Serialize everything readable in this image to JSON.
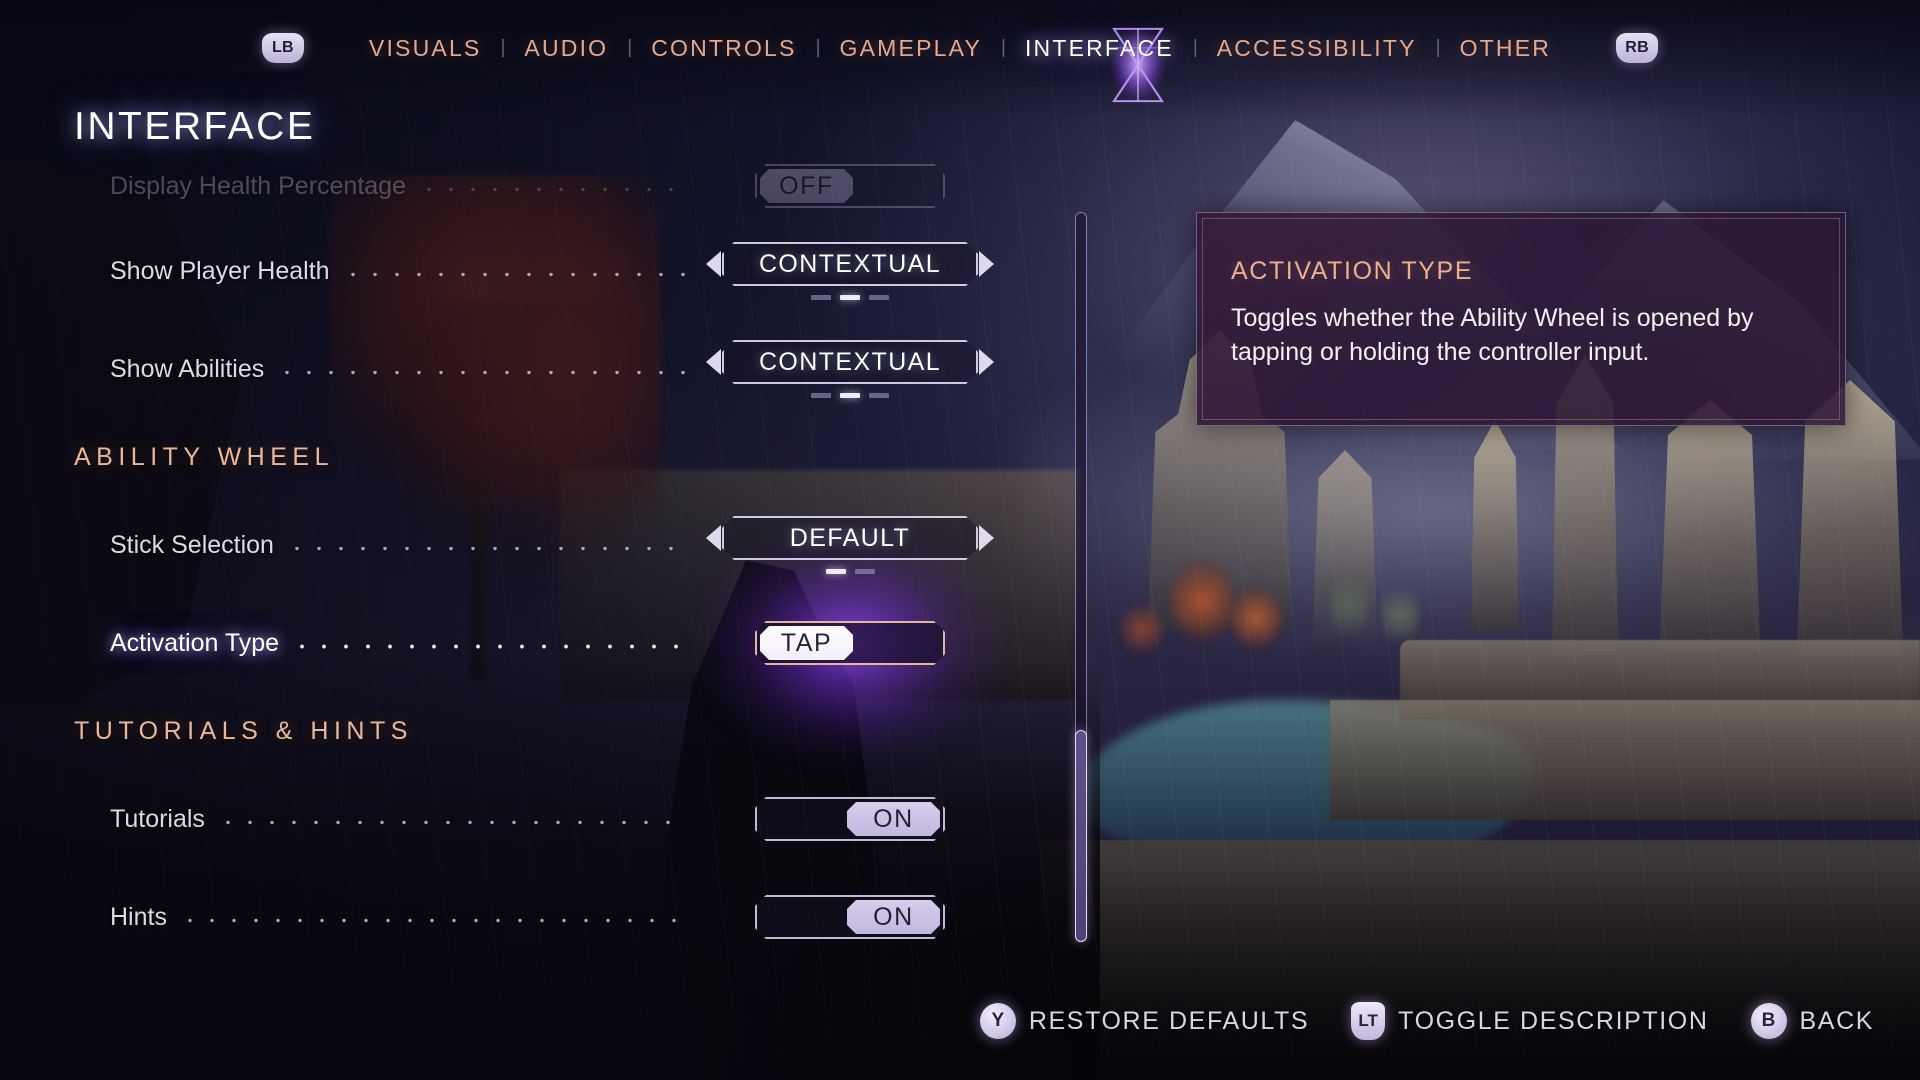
{
  "nav": {
    "left_bumper": "LB",
    "right_bumper": "RB",
    "separator": "|",
    "tabs": [
      {
        "label": "VISUALS",
        "active": false
      },
      {
        "label": "AUDIO",
        "active": false
      },
      {
        "label": "CONTROLS",
        "active": false
      },
      {
        "label": "GAMEPLAY",
        "active": false
      },
      {
        "label": "INTERFACE",
        "active": true
      },
      {
        "label": "ACCESSIBILITY",
        "active": false
      },
      {
        "label": "OTHER",
        "active": false
      }
    ]
  },
  "page": {
    "title": "INTERFACE"
  },
  "settings": [
    {
      "kind": "row",
      "label": "Display Health Percentage",
      "faded": true,
      "selected": false,
      "control": {
        "type": "toggle",
        "value": "OFF",
        "side": "left"
      }
    },
    {
      "kind": "row",
      "label": "Show Player Health",
      "faded": false,
      "selected": false,
      "control": {
        "type": "selector",
        "value": "CONTEXTUAL",
        "options_count": 3,
        "selected_index": 1
      }
    },
    {
      "kind": "row",
      "label": "Show Abilities",
      "faded": false,
      "selected": false,
      "control": {
        "type": "selector",
        "value": "CONTEXTUAL",
        "options_count": 3,
        "selected_index": 1
      }
    },
    {
      "kind": "section",
      "label": "ABILITY WHEEL"
    },
    {
      "kind": "row",
      "label": "Stick Selection",
      "faded": false,
      "selected": false,
      "control": {
        "type": "selector",
        "value": "DEFAULT",
        "options_count": 2,
        "selected_index": 0
      }
    },
    {
      "kind": "row",
      "label": "Activation Type",
      "faded": false,
      "selected": true,
      "control": {
        "type": "toggle",
        "value": "TAP",
        "side": "left"
      }
    },
    {
      "kind": "section",
      "label": "TUTORIALS & HINTS"
    },
    {
      "kind": "row",
      "label": "Tutorials",
      "faded": false,
      "selected": false,
      "control": {
        "type": "toggle",
        "value": "ON",
        "side": "right"
      }
    },
    {
      "kind": "row",
      "label": "Hints",
      "faded": false,
      "selected": false,
      "control": {
        "type": "toggle",
        "value": "ON",
        "side": "right"
      }
    }
  ],
  "tooltip": {
    "title": "ACTIVATION TYPE",
    "body": "Toggles whether the Ability Wheel is opened by tapping or holding the controller input."
  },
  "footer": {
    "prompts": [
      {
        "button": "Y",
        "button_shape": "round",
        "label": "RESTORE DEFAULTS"
      },
      {
        "button": "LT",
        "button_shape": "trigger",
        "label": "TOGGLE DESCRIPTION"
      },
      {
        "button": "B",
        "button_shape": "round",
        "label": "BACK"
      }
    ]
  },
  "scrollbar": {
    "thumb_position": "bottom",
    "thumb_fraction": 0.29
  },
  "colors": {
    "nav_inactive": "#e3a98e",
    "nav_active": "#ffffff",
    "section_header": "#e9b79c",
    "tooltip_title": "#ecb08f",
    "selection_glow": "#9646f5",
    "control_border": "#e2def2",
    "pill": "#d7cdec"
  }
}
